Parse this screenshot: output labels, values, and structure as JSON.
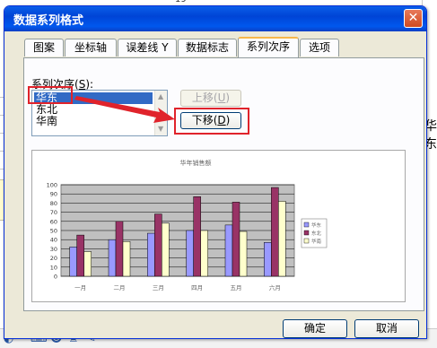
{
  "dialog": {
    "title": "数据系列格式",
    "close_label": "✕",
    "tabs": [
      "图案",
      "坐标轴",
      "误差线 Y",
      "数据标志",
      "系列次序",
      "选项"
    ],
    "active_tab": "系列次序"
  },
  "series_order": {
    "label": "系列次序(",
    "label_key": "S",
    "label_end": "):",
    "items": [
      "华东",
      "东北",
      "华南"
    ],
    "selected": "华东",
    "move_up_label": "上移(",
    "move_up_key": "U",
    "move_down_label": "下移(",
    "move_down_key": "D",
    "close_paren": ")"
  },
  "footer": {
    "ok_label": "确定",
    "cancel_label": "取消"
  },
  "background": {
    "right_text": [
      "华",
      "东"
    ],
    "top_number": "19"
  },
  "colors": {
    "highlight": "#e0232b",
    "series_1": "#9999ff",
    "series_2": "#993366",
    "series_3": "#ffffcc"
  },
  "chart_data": {
    "type": "bar",
    "title": "华年销售额",
    "categories": [
      "一月",
      "二月",
      "三月",
      "四月",
      "五月",
      "六月"
    ],
    "series": [
      {
        "name": "华东",
        "values": [
          32,
          40,
          47,
          50,
          56,
          37
        ]
      },
      {
        "name": "东北",
        "values": [
          45,
          60,
          68,
          87,
          81,
          97
        ]
      },
      {
        "name": "华南",
        "values": [
          27,
          38,
          58,
          50,
          49,
          82
        ]
      }
    ],
    "ylim": [
      0,
      100
    ],
    "yticks": [
      0,
      10,
      20,
      30,
      40,
      50,
      60,
      70,
      80,
      90,
      100
    ],
    "grid": true,
    "legend": "right"
  }
}
